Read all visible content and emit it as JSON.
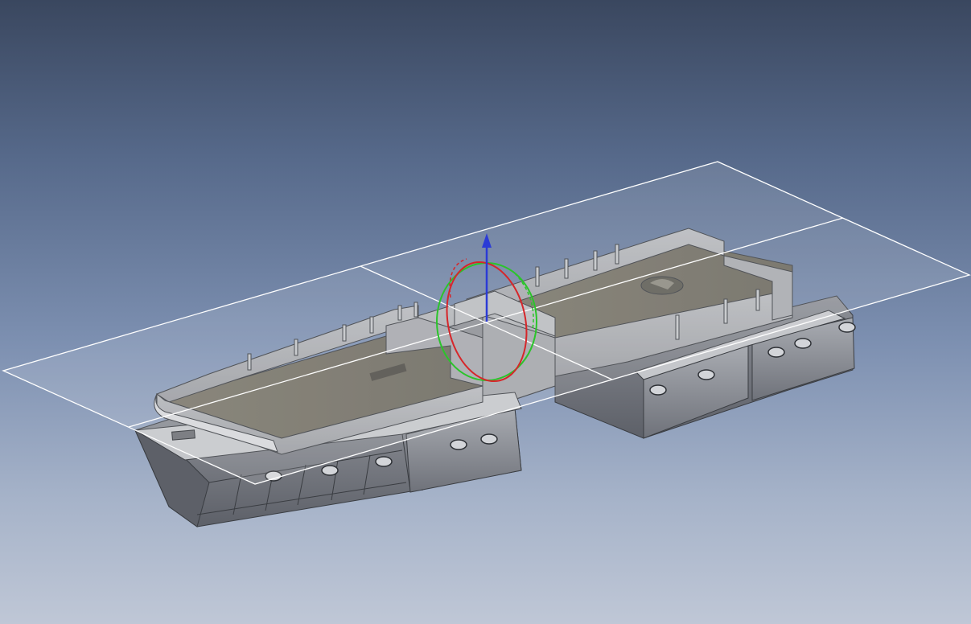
{
  "viewport": {
    "background_top": "#3a475f",
    "background_bottom": "#bfc7d6"
  },
  "model": {
    "type": "ship-hull-3d-model",
    "hull_color": "#9b9ea4",
    "deck_color": "#6f6c61",
    "edge_color": "#3a3d42"
  },
  "reference_plane": {
    "edge_color": "#ffffff",
    "fill_opacity": 0.12
  },
  "triad": {
    "z_axis_color": "#2b3bd6",
    "x_ring_color": "#d6262a",
    "y_ring_color": "#2bc42b"
  }
}
